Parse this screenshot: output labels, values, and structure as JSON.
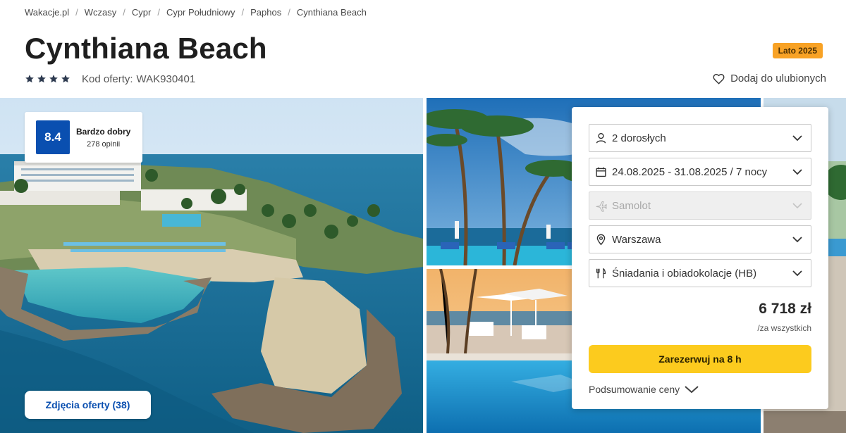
{
  "breadcrumb": [
    "Wakacje.pl",
    "Wczasy",
    "Cypr",
    "Cypr Południowy",
    "Paphos",
    "Cynthiana Beach"
  ],
  "hotel": {
    "name": "Cynthiana Beach",
    "stars": 4,
    "offer_code_label": "Kod oferty:",
    "offer_code": "WAK930401",
    "season_badge": "Lato 2025",
    "favorite_label": "Dodaj do ulubionych"
  },
  "rating": {
    "score": "8.4",
    "label": "Bardzo dobry",
    "count": "278 opinii"
  },
  "gallery": {
    "button_label": "Zdjęcia oferty (38)"
  },
  "booking": {
    "travelers": "2 dorosłych",
    "dates": "24.08.2025 - 31.08.2025 / 7 nocy",
    "transport": "Samolot",
    "departure": "Warszawa",
    "board": "Śniadania i obiadokolacje (HB)",
    "price": "6 718 zł",
    "price_note": "/za wszystkich",
    "book_label": "Zarezerwuj na 8 h",
    "summary_label": "Podsumowanie ceny"
  },
  "colors": {
    "brand_blue": "#0a4fb0",
    "cta_yellow": "#fccb1e",
    "badge_orange": "#f8a225"
  },
  "icons": {
    "travelers": "person-icon",
    "dates": "calendar-icon",
    "transport": "plane-icon",
    "departure": "location-pin-icon",
    "board": "cutlery-icon",
    "favorite": "heart-icon"
  }
}
